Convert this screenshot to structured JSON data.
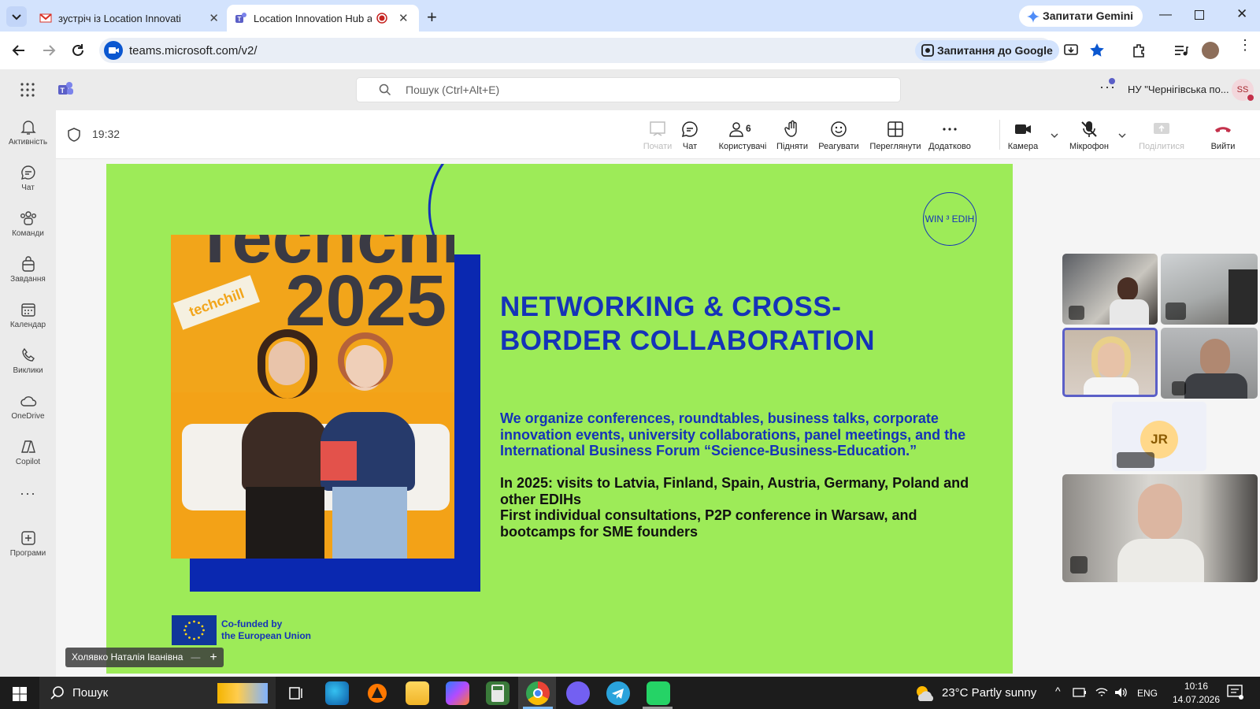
{
  "browser": {
    "tabs": [
      {
        "title": "зустріч із Location Innovation Hub",
        "favicon": "gmail-icon"
      },
      {
        "title": "Location Innovation Hub and",
        "favicon": "teams-icon",
        "recording": true
      }
    ],
    "gemini_label": "Запитати Gemini",
    "url": "teams.microsoft.com/v2/",
    "ask_google_label": "Запитання до Google"
  },
  "teams": {
    "search_placeholder": "Пошук (Ctrl+Alt+E)",
    "org_name": "НУ \"Чернігівська по...",
    "avatar_initials": "SS",
    "rail": [
      {
        "label": "Активність",
        "icon": "bell-icon"
      },
      {
        "label": "Чат",
        "icon": "chat-icon"
      },
      {
        "label": "Команди",
        "icon": "teams-group-icon"
      },
      {
        "label": "Завдання",
        "icon": "tasks-icon"
      },
      {
        "label": "Календар",
        "icon": "calendar-icon"
      },
      {
        "label": "Виклики",
        "icon": "phone-icon"
      },
      {
        "label": "OneDrive",
        "icon": "cloud-icon"
      },
      {
        "label": "Copilot",
        "icon": "copilot-icon"
      },
      {
        "label": "Програми",
        "icon": "apps-add-icon"
      }
    ],
    "meeting": {
      "timer": "19:32",
      "toolbar": {
        "start": "Почати",
        "chat": "Чат",
        "people": "Користувачі",
        "people_count": "6",
        "raise": "Підняти",
        "react": "Реагувати",
        "view": "Переглянути",
        "more": "Додатково",
        "camera": "Камера",
        "mic": "Мікрофон",
        "share": "Поділитися",
        "leave": "Вийти"
      },
      "presenter_name": "Холявко Наталія Іванівна",
      "participants": [
        {
          "initials": "JR"
        }
      ]
    }
  },
  "slide": {
    "logo": "WIN ³ EDIH",
    "photo_text_top": "Techchill",
    "photo_text_year": "2025",
    "photo_sign": "techchill",
    "title": "NETWORKING & CROSS-BORDER COLLABORATION",
    "paragraph_blue": "We organize conferences, roundtables, business talks, corporate innovation events, university collaborations, panel meetings, and the International Business Forum “Science-Business-Education.”",
    "paragraph_2": "In 2025: visits to Latvia, Finland, Spain, Austria, Germany, Poland and other EDIHs",
    "paragraph_3": "First individual consultations, P2P conference in Warsaw, and bootcamps for SME founders",
    "eu_line1": "Co-funded by",
    "eu_line2": "the European Union"
  },
  "taskbar": {
    "search_label": "Пошук",
    "weather": "23°C  Partly sunny",
    "lang": "ENG",
    "time": "10:16",
    "date": "14.07.2026"
  },
  "colors": {
    "slide_bg": "#9deb58",
    "slide_blue": "#1533b8",
    "teams_purple": "#5b5fc7",
    "leave_red": "#c4314b"
  }
}
